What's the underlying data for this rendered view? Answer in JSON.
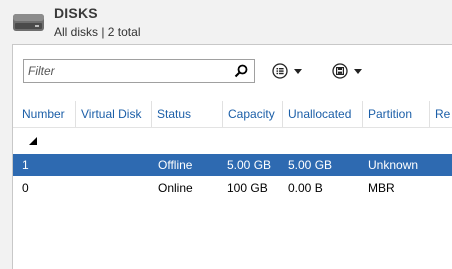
{
  "header": {
    "title": "DISKS",
    "subtitle": "All disks | 2 total"
  },
  "toolbar": {
    "filter_placeholder": "Filter",
    "view_menu_icon": "list-view-icon",
    "save_menu_icon": "save-icon"
  },
  "columns": [
    "Number",
    "Virtual Disk",
    "Status",
    "Capacity",
    "Unallocated",
    "Partition",
    "Re"
  ],
  "rows": [
    {
      "number": "1",
      "virtual_disk": "",
      "status": "Offline",
      "capacity": "5.00 GB",
      "unallocated": "5.00 GB",
      "partition": "Unknown",
      "selected": true
    },
    {
      "number": "0",
      "virtual_disk": "",
      "status": "Online",
      "capacity": "100 GB",
      "unallocated": "0.00 B",
      "partition": "MBR",
      "selected": false
    }
  ],
  "colors": {
    "header_link": "#1c5fa8",
    "selection": "#2e6ab1"
  }
}
